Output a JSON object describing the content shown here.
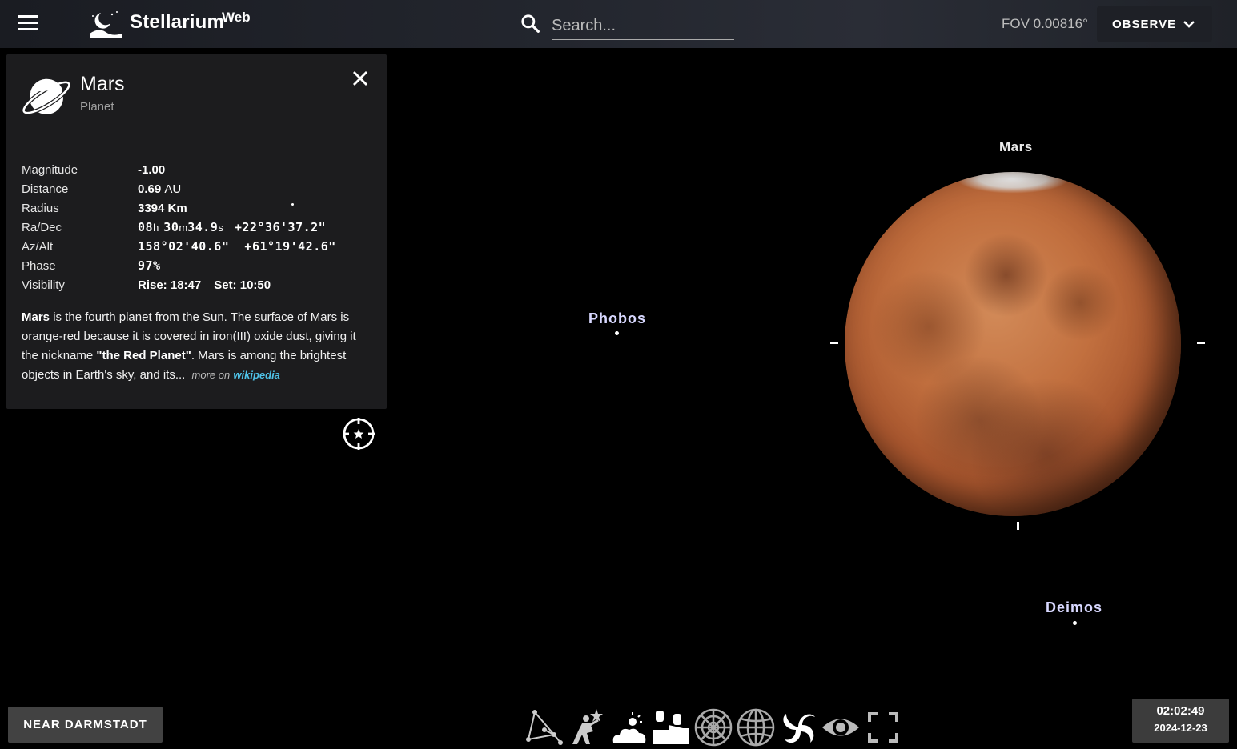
{
  "header": {
    "app_name": "Stellarium",
    "app_suffix": "Web",
    "search_placeholder": "Search...",
    "fov": "FOV 0.00816°",
    "observe_label": "OBSERVE"
  },
  "info_panel": {
    "name": "Mars",
    "type": "Planet",
    "properties": [
      {
        "label": "Magnitude",
        "value": "-1.00"
      },
      {
        "label": "Distance",
        "value": "0.69",
        "unit": "AU"
      },
      {
        "label": "Radius",
        "value": "3394 Km"
      },
      {
        "label": "Ra/Dec",
        "ra_h": "08",
        "ra_h_unit": "h",
        "ra_m": "30",
        "ra_m_unit": "m",
        "ra_s": "34.9",
        "ra_s_unit": "s",
        "dec": "+22°36'37.2\""
      },
      {
        "label": "Az/Alt",
        "value": "158°02'40.6\"  +61°19'42.6\""
      },
      {
        "label": "Phase",
        "value": "97%"
      },
      {
        "label": "Visibility",
        "rise": "Rise: 18:47",
        "set": "Set: 10:50"
      }
    ],
    "description": {
      "bold_start": "Mars",
      "text1": " is the fourth planet from the Sun. The surface of Mars is orange-red because it is covered in iron(III) oxide dust, giving it the nickname ",
      "bold_mid": "\"the Red Planet\"",
      "text2": ". Mars is among the brightest objects in Earth's sky, and its...",
      "more_on": "more on",
      "link": "wikipedia"
    }
  },
  "sky": {
    "mars_label": "Mars",
    "phobos_label": "Phobos",
    "deimos_label": "Deimos"
  },
  "footer": {
    "location": "NEAR DARMSTADT",
    "time": "02:02:49",
    "date": "2024-12-23"
  },
  "toolbar_icons": [
    "constellations-lines-icon",
    "constellations-art-icon",
    "atmosphere-icon",
    "landscape-icon",
    "azimuthal-grid-icon",
    "equatorial-grid-icon",
    "deep-sky-objects-icon",
    "night-mode-icon",
    "fullscreen-icon"
  ]
}
